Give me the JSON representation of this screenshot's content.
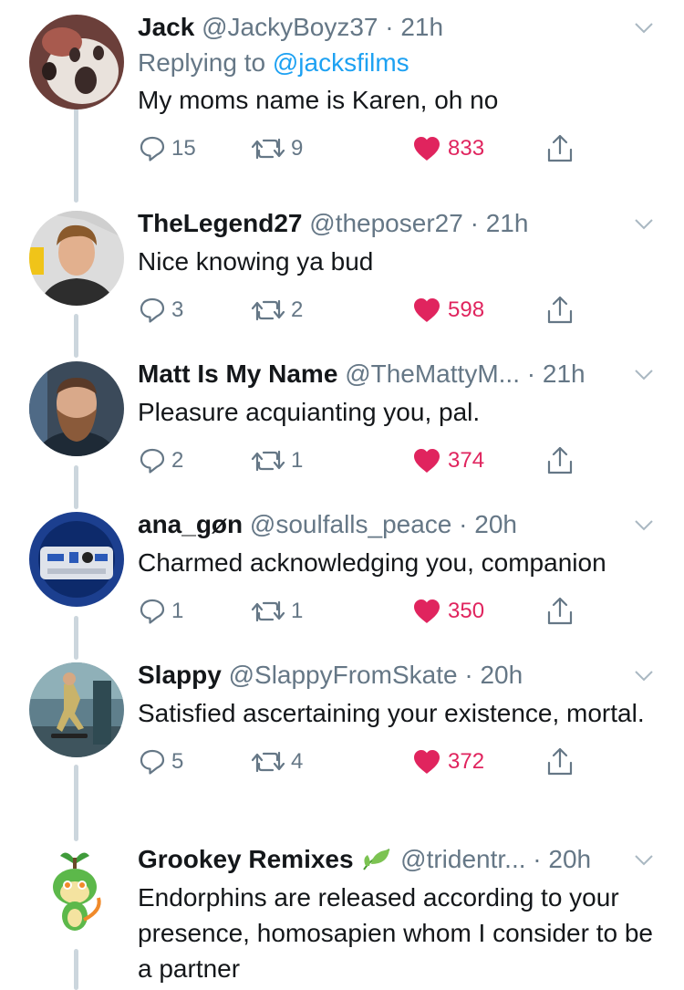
{
  "colors": {
    "link": "#1da1f2",
    "muted": "#657786",
    "text": "#14171a",
    "like": "#e0245e",
    "thread_line": "#ccd6dd"
  },
  "tweets": [
    {
      "name": "Jack",
      "handle": "@JackyBoyz37",
      "dot": "·",
      "time": "21h",
      "replying_to_label": "Replying to",
      "replying_to_handle": "@jacksfilms",
      "text": "My moms name is Karen, oh no",
      "replies": "15",
      "retweets": "9",
      "likes": "833",
      "avatar": "shocked-figure-avatar"
    },
    {
      "name": "TheLegend27",
      "handle": "@theposer27",
      "dot": "·",
      "time": "21h",
      "text": "Nice knowing ya bud",
      "replies": "3",
      "retweets": "2",
      "likes": "598",
      "avatar": "young-man-avatar"
    },
    {
      "name": "Matt Is My Name",
      "handle": "@TheMattyM...",
      "dot": "·",
      "time": "21h",
      "text": "Pleasure acquianting you, pal.",
      "replies": "2",
      "retweets": "1",
      "likes": "374",
      "avatar": "bearded-man-avatar"
    },
    {
      "name": "ana_gøn",
      "handle": "@soulfalls_peace",
      "dot": "·",
      "time": "20h",
      "text": "Charmed acknowledging you, companion",
      "replies": "1",
      "retweets": "1",
      "likes": "350",
      "avatar": "r2d2-avatar"
    },
    {
      "name": "Slappy",
      "handle": "@SlappyFromSkate",
      "dot": "·",
      "time": "20h",
      "text": "Satisfied ascertaining your existence, mortal.",
      "replies": "5",
      "retweets": "4",
      "likes": "372",
      "avatar": "skater-avatar"
    },
    {
      "name": "Grookey Remixes",
      "handle": "@tridentr...",
      "dot": "·",
      "time": "20h",
      "text": "Endorphins are released according to your presence, homosapien whom I consider to be a partner",
      "avatar": "grookey-avatar",
      "name_icon": "leaf-emoji-icon"
    }
  ]
}
